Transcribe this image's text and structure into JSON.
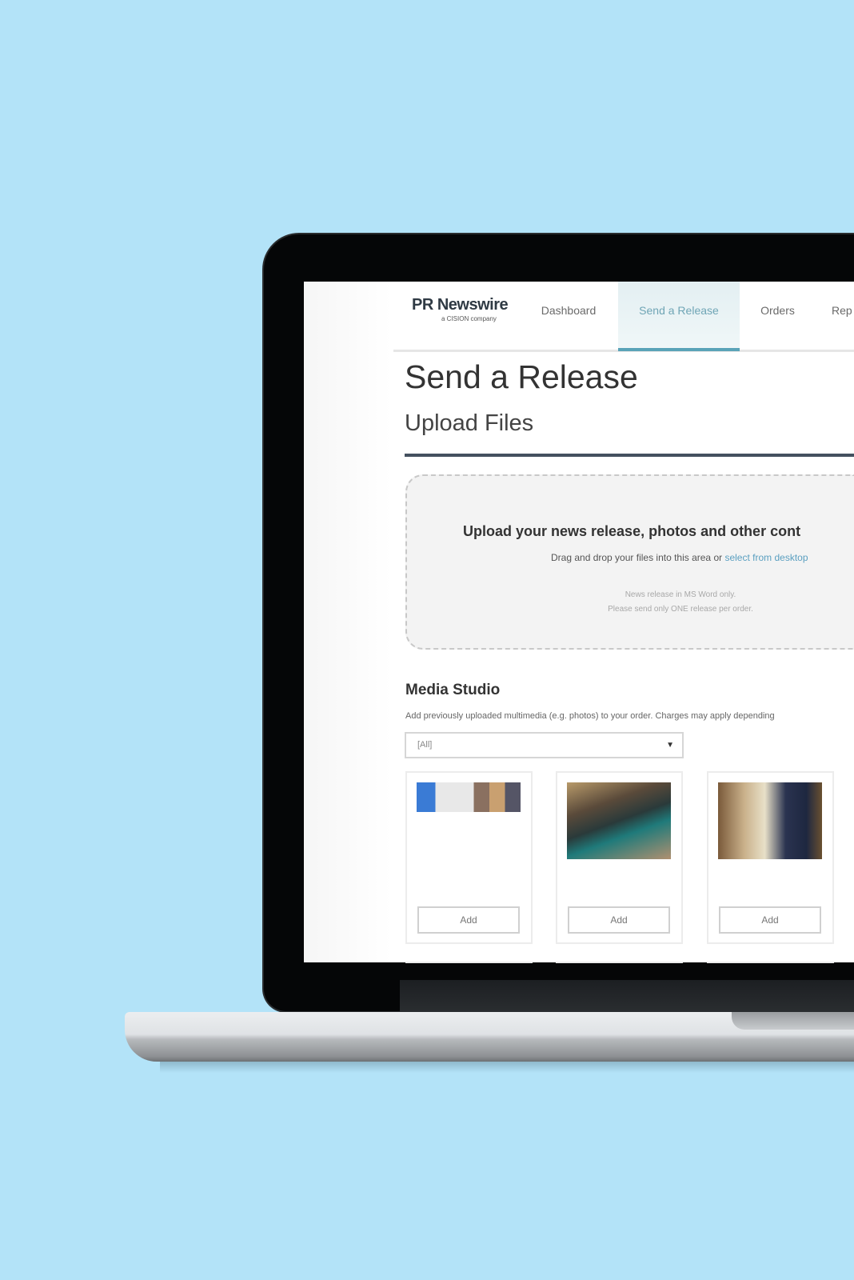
{
  "app": {
    "logo": "PR Newswire",
    "logo_sub": "a CISION company"
  },
  "nav": {
    "items": [
      {
        "label": "Dashboard"
      },
      {
        "label": "Send a Release",
        "active": true
      },
      {
        "label": "Orders"
      },
      {
        "label": "Rep"
      }
    ],
    "accent": "#5aa3b8"
  },
  "page": {
    "title": "Send a Release",
    "subtitle": "Upload Files"
  },
  "upload": {
    "heading": "Upload your news release, photos and other cont",
    "drag_text": "Drag and drop your files into this area or ",
    "link": "select from desktop",
    "note1": "News release in MS Word only.",
    "note2": "Please send only ONE release per order."
  },
  "media": {
    "heading": "Media Studio",
    "description": "Add previously uploaded multimedia (e.g. photos) to your order. Charges may apply depending",
    "filter": "[All]",
    "items": [
      {
        "add_label": "Add"
      },
      {
        "add_label": "Add"
      },
      {
        "add_label": "Add"
      }
    ]
  }
}
